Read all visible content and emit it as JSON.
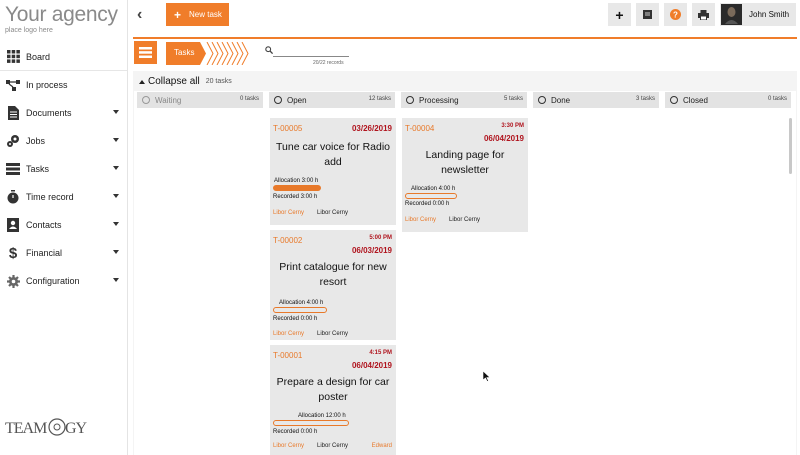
{
  "brand": {
    "title": "Your agency",
    "subtitle": "place logo here"
  },
  "sidebar": {
    "items": [
      {
        "label": "Board",
        "icon": "grid-icon"
      },
      {
        "label": "In process",
        "icon": "flow-icon"
      },
      {
        "label": "Documents",
        "icon": "document-icon"
      },
      {
        "label": "Jobs",
        "icon": "gears-icon"
      },
      {
        "label": "Tasks",
        "icon": "tasks-icon"
      },
      {
        "label": "Time record",
        "icon": "stopwatch-icon"
      },
      {
        "label": "Contacts",
        "icon": "contact-card-icon"
      },
      {
        "label": "Financial",
        "icon": "dollar-icon"
      },
      {
        "label": "Configuration",
        "icon": "gear-icon"
      }
    ],
    "footer_logo": "TEAMOGY"
  },
  "topbar": {
    "new_task_label": "New task",
    "user_name": "John Smith"
  },
  "board": {
    "chip_label": "Tasks",
    "search_placeholder": "",
    "records": "20/22 records",
    "collapse_label": "Collapse all",
    "collapse_count": "20 tasks"
  },
  "columns": [
    {
      "name": "Waiting",
      "count": "0 tasks"
    },
    {
      "name": "Open",
      "count": "12 tasks"
    },
    {
      "name": "Processing",
      "count": "5 tasks"
    },
    {
      "name": "Done",
      "count": "3 tasks"
    },
    {
      "name": "Closed",
      "count": "0 tasks"
    }
  ],
  "cards": {
    "open": [
      {
        "id": "T-00005",
        "time": "",
        "date": "03/26/2019",
        "title_line1": "Tune car voice for Radio",
        "title_line2": "add",
        "allocation": "Allocation 3:00 h",
        "recorded": "Recorded 3:00 h",
        "progress": 1.0,
        "person1": "Libor Cerny",
        "person2": "Libor Cerny",
        "person3": ""
      },
      {
        "id": "T-00002",
        "time": "5:00 PM",
        "date": "06/03/2019",
        "title_line1": "Print catalogue for new",
        "title_line2": "resort",
        "allocation": "Allocation 4:00 h",
        "recorded": "Recorded 0:00 h",
        "progress": 0.0,
        "person1": "Libor Cerny",
        "person2": "Libor Cerny",
        "person3": ""
      },
      {
        "id": "T-00001",
        "time": "4:15 PM",
        "date": "06/04/2019",
        "title_line1": "Prepare a design for car",
        "title_line2": "poster",
        "allocation": "Allocation 12:00 h",
        "recorded": "Recorded 0:00 h",
        "progress": 0.0,
        "person1": "Libor Cerny",
        "person2": "Libor Cerny",
        "person3": "Edward"
      }
    ],
    "processing": [
      {
        "id": "T-00004",
        "time": "3:30 PM",
        "date": "06/04/2019",
        "title_line1": "Landing page for",
        "title_line2": "newsletter",
        "allocation": "Allocation 4:00 h",
        "recorded": "Recorded 0:00 h",
        "progress": 0.0,
        "person1": "Libor Cerny",
        "person2": "Libor Cerny"
      }
    ]
  },
  "colors": {
    "accent": "#f07d2a",
    "date_red": "#b0141e",
    "card_bg": "#e8e8e8"
  }
}
